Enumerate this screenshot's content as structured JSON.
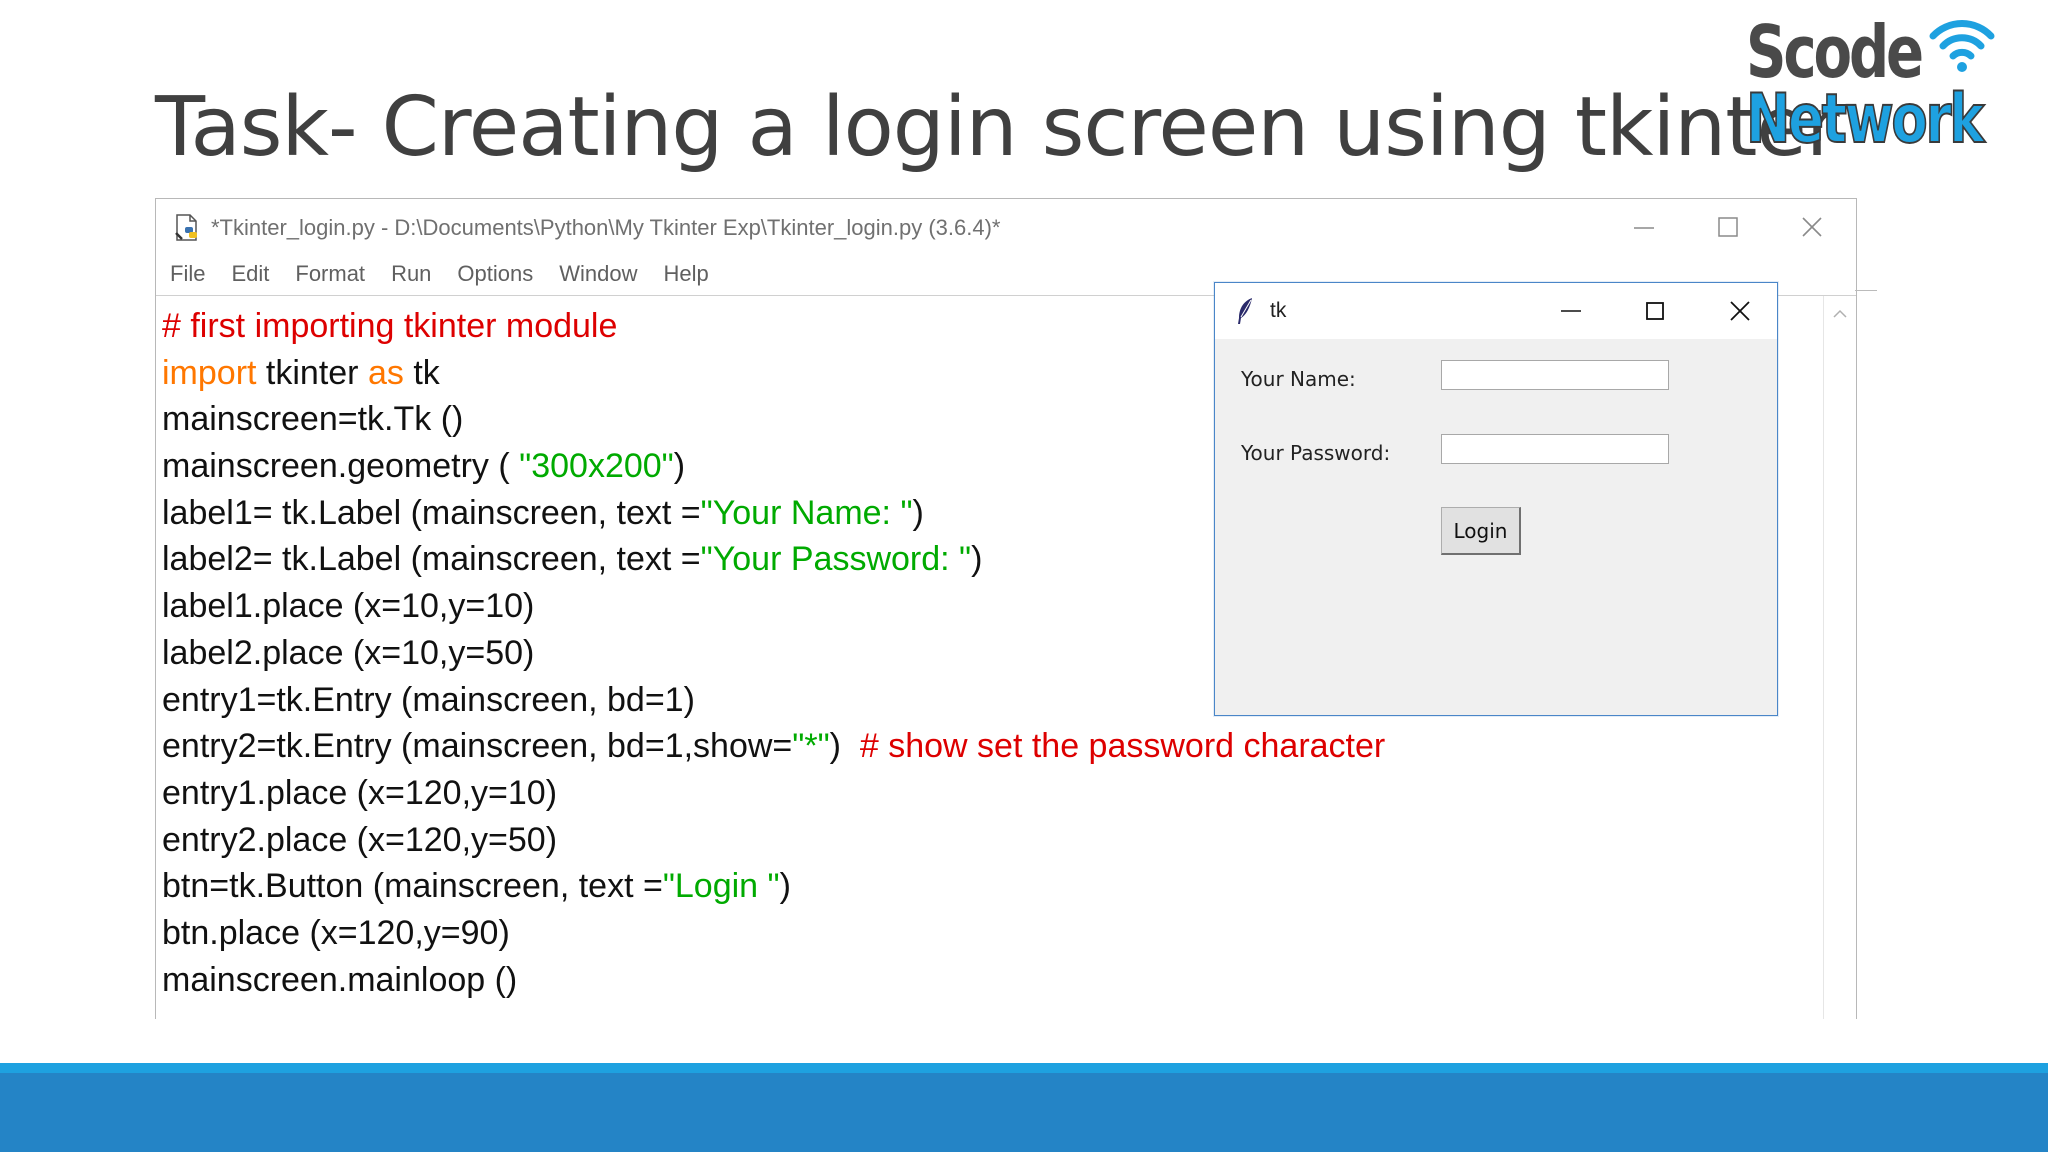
{
  "slide": {
    "title": "Task- Creating a login screen using tkinter"
  },
  "logo": {
    "line1": "Scode",
    "line2": "Network"
  },
  "ide": {
    "title": "*Tkinter_login.py - D:\\Documents\\Python\\My Tkinter Exp\\Tkinter_login.py (3.6.4)*",
    "file_icon": "python-file-icon",
    "menu": [
      "File",
      "Edit",
      "Format",
      "Run",
      "Options",
      "Window",
      "Help"
    ],
    "code_lines": [
      [
        {
          "t": "# first importing tkinter module",
          "c": "comment"
        }
      ],
      [
        {
          "t": "import",
          "c": "keyword"
        },
        {
          "t": " tkinter ",
          "c": "plain"
        },
        {
          "t": "as",
          "c": "keyword"
        },
        {
          "t": " tk",
          "c": "plain"
        }
      ],
      [
        {
          "t": "mainscreen=tk.Tk ()",
          "c": "plain"
        }
      ],
      [
        {
          "t": "mainscreen.geometry ( ",
          "c": "plain"
        },
        {
          "t": "\"300x200\"",
          "c": "string"
        },
        {
          "t": ")",
          "c": "plain"
        }
      ],
      [
        {
          "t": "label1= tk.Label (mainscreen, text =",
          "c": "plain"
        },
        {
          "t": "\"Your Name: \"",
          "c": "string"
        },
        {
          "t": ")",
          "c": "plain"
        }
      ],
      [
        {
          "t": "label2= tk.Label (mainscreen, text =",
          "c": "plain"
        },
        {
          "t": "\"Your Password: \"",
          "c": "string"
        },
        {
          "t": ")",
          "c": "plain"
        }
      ],
      [
        {
          "t": "label1.place (x=10,y=10)",
          "c": "plain"
        }
      ],
      [
        {
          "t": "label2.place (x=10,y=50)",
          "c": "plain"
        }
      ],
      [
        {
          "t": "entry1=tk.Entry (mainscreen, bd=1)",
          "c": "plain"
        }
      ],
      [
        {
          "t": "entry2=tk.Entry (mainscreen, bd=1,show=",
          "c": "plain"
        },
        {
          "t": "\"*\"",
          "c": "string"
        },
        {
          "t": ")  ",
          "c": "plain"
        },
        {
          "t": "# show set the password character",
          "c": "comment"
        }
      ],
      [
        {
          "t": "entry1.place (x=120,y=10)",
          "c": "plain"
        }
      ],
      [
        {
          "t": "entry2.place (x=120,y=50)",
          "c": "plain"
        }
      ],
      [
        {
          "t": "btn=tk.Button (mainscreen, text =",
          "c": "plain"
        },
        {
          "t": "\"Login \"",
          "c": "string"
        },
        {
          "t": ")",
          "c": "plain"
        }
      ],
      [
        {
          "t": "btn.place (x=120,y=90)",
          "c": "plain"
        }
      ],
      [
        {
          "t": "mainscreen.mainloop ()",
          "c": "plain"
        }
      ]
    ]
  },
  "tk_window": {
    "title": "tk",
    "icon": "feather-icon",
    "name_label": "Your Name:",
    "name_value": "",
    "password_label": "Your Password:",
    "password_value": "",
    "login_button": "Login"
  },
  "colors": {
    "comment": "#dd0000",
    "keyword": "#ff7700",
    "string": "#00aa00",
    "band_light": "#1ea1e0",
    "band_dark": "#2484c6"
  }
}
